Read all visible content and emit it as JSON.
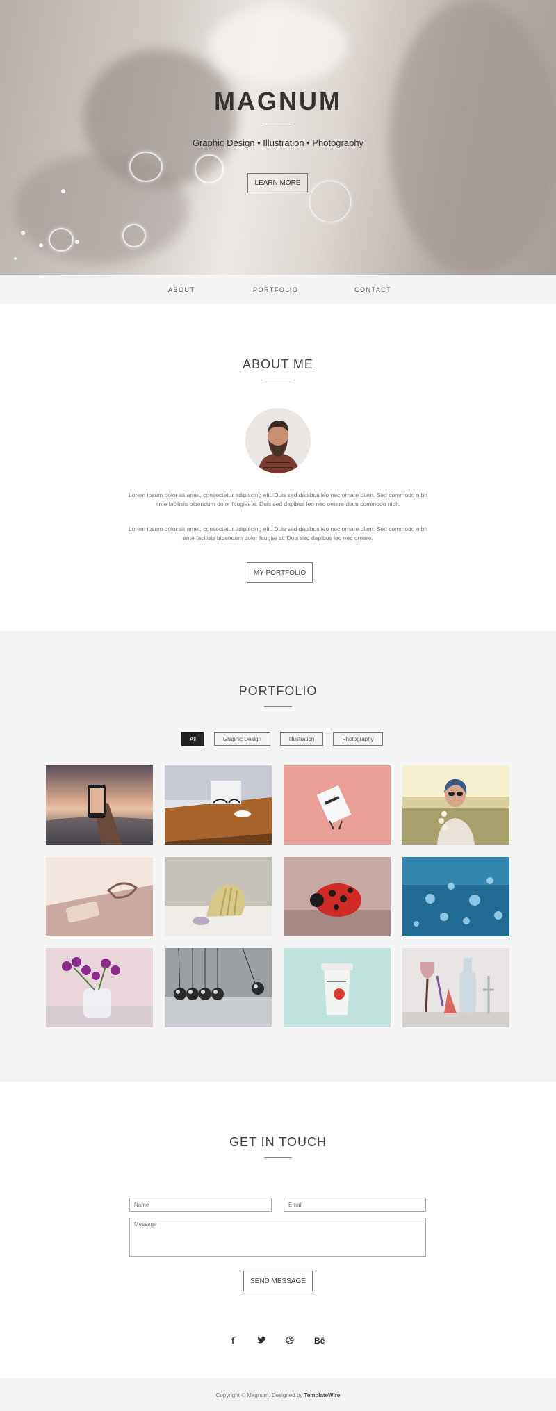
{
  "hero": {
    "title": "MAGNUM",
    "subtitle": "Graphic Design • Illustration • Photography",
    "button": "LEARN MORE"
  },
  "nav": [
    "ABOUT",
    "PORTFOLIO",
    "CONTACT"
  ],
  "about": {
    "title": "ABOUT ME",
    "paragraphs": [
      "Lorem ipsum dolor sit amet, consectetur adipiscing elit. Duis sed dapibus leo nec ornare diam. Sed commodo nibh ante facilisis bibendum dolor feugiat at. Duis sed dapibus leo nec ornare diam commodo nibh.",
      "Lorem ipsum dolor sit amet, consectetur adipiscing elit. Duis sed dapibus leo nec ornare diam. Sed commodo nibh ante facilisis bibendum dolor feugiat at. Duis sed dapibus leo nec ornare."
    ],
    "button": "MY PORTFOLIO"
  },
  "portfolio": {
    "title": "PORTFOLIO",
    "filters": [
      "All",
      "Graphic Design",
      "Illustration",
      "Photography"
    ],
    "active_filter": "All"
  },
  "contact": {
    "title": "GET IN TOUCH",
    "name_placeholder": "Name",
    "email_placeholder": "Email",
    "message_placeholder": "Message",
    "button": "SEND MESSAGE"
  },
  "social": [
    "f",
    "t",
    "d",
    "Bē"
  ],
  "footer": {
    "prefix": "Copyright © Magnum. Designed by",
    "link": "TemplateWire"
  },
  "colors": {
    "accent": "#222222",
    "section_bg": "#f5f5f5"
  }
}
